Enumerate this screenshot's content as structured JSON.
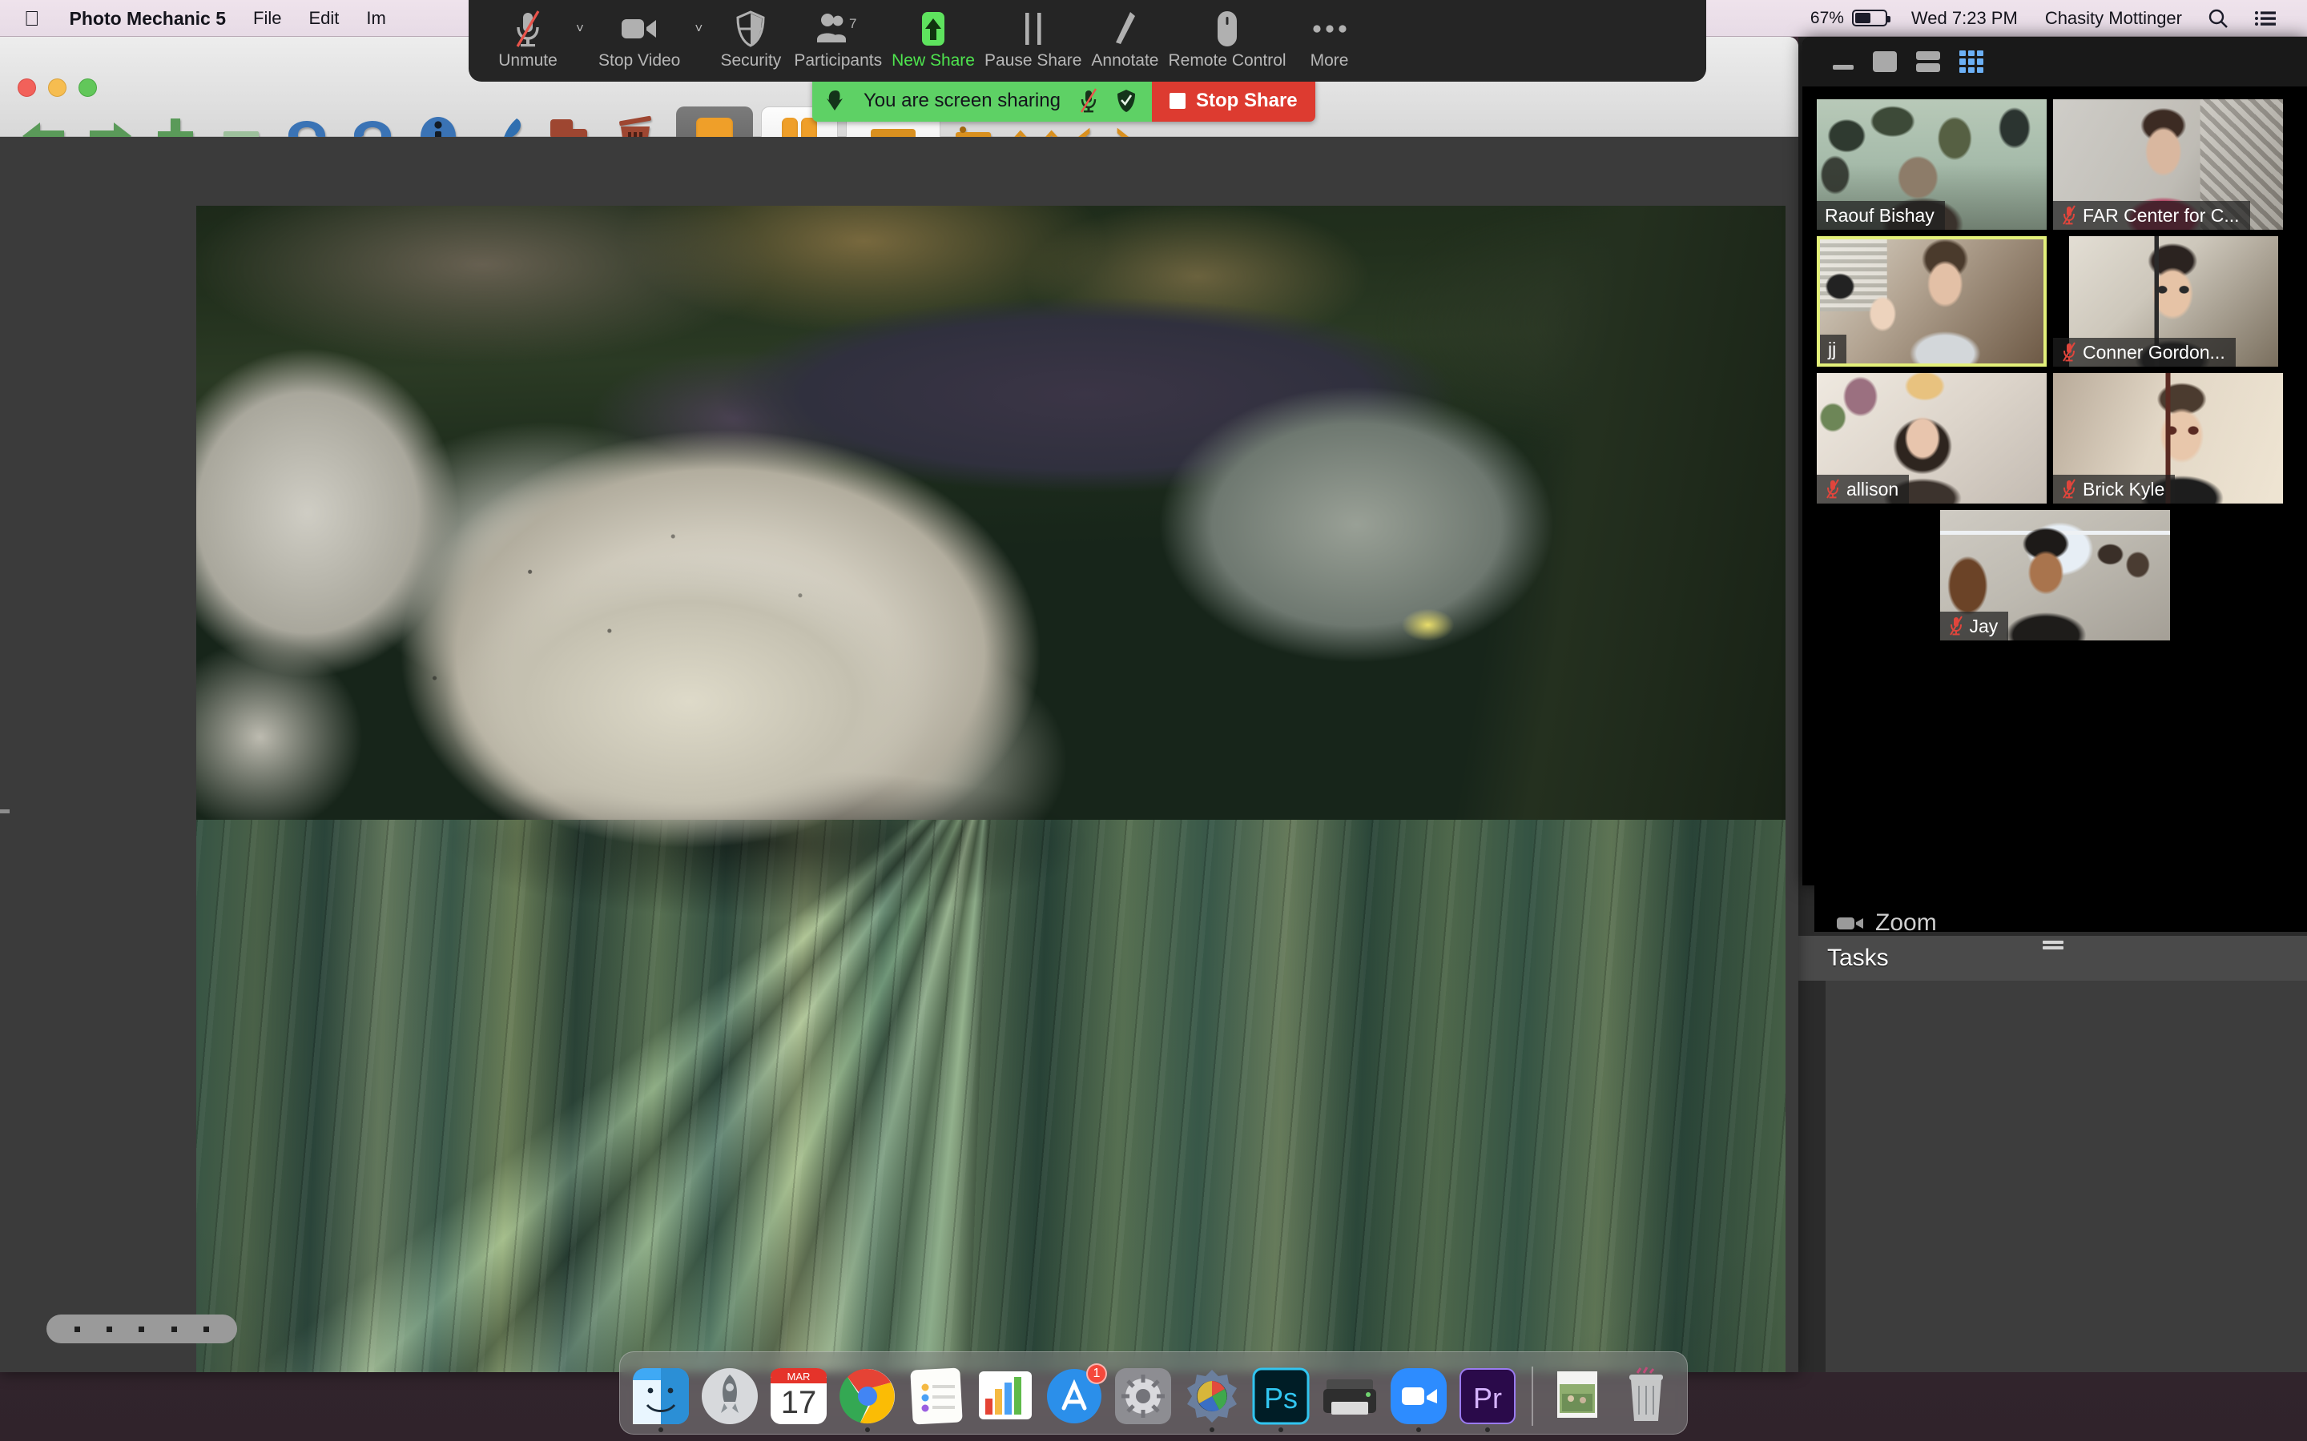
{
  "menubar": {
    "apple_icon": "apple-logo-icon",
    "app_name": "Photo Mechanic 5",
    "menus": [
      "File",
      "Edit",
      "Im"
    ],
    "battery_percent": "67%",
    "clock": "Wed 7:23 PM",
    "user": "Chasity Mottinger",
    "search_icon": "search-icon",
    "control_center_icon": "list-icon"
  },
  "zoom_toolbar": {
    "items": [
      {
        "label": "Unmute",
        "icon": "microphone-muted-icon",
        "caret": true,
        "active": false
      },
      {
        "label": "Stop Video",
        "icon": "video-camera-icon",
        "caret": true,
        "active": false
      },
      {
        "label": "Security",
        "icon": "shield-icon",
        "caret": false,
        "active": false
      },
      {
        "label": "Participants",
        "icon": "participants-icon",
        "caret": false,
        "active": false,
        "count": "7"
      },
      {
        "label": "New Share",
        "icon": "share-screen-up-arrow-icon",
        "caret": false,
        "active": true
      },
      {
        "label": "Pause Share",
        "icon": "pause-icon",
        "caret": false,
        "active": false
      },
      {
        "label": "Annotate",
        "icon": "pen-icon",
        "caret": false,
        "active": false
      },
      {
        "label": "Remote Control",
        "icon": "mouse-icon",
        "caret": false,
        "active": false
      },
      {
        "label": "More",
        "icon": "ellipsis-icon",
        "caret": false,
        "active": false
      }
    ]
  },
  "share_bar": {
    "down_arrow_icon": "arrow-down-icon",
    "message": "You are screen sharing",
    "mic_icon": "microphone-muted-icon",
    "shield_icon": "shield-check-icon",
    "stop_label": "Stop Share",
    "green_hex": "#5ED165",
    "red_hex": "#DD3B30"
  },
  "photo_mechanic": {
    "window_title": "Photo Mechanic 5",
    "traffic_lights": [
      "close-button",
      "minimize-button",
      "zoom-button"
    ],
    "toolbar": [
      {
        "name": "previous-image-button",
        "icon": "arrow-left-icon"
      },
      {
        "name": "next-image-button",
        "icon": "arrow-right-icon"
      },
      {
        "name": "increase-rating-button",
        "icon": "plus-icon"
      },
      {
        "name": "decrease-rating-button",
        "icon": "minus-icon"
      },
      {
        "name": "undo-button",
        "icon": "undo-arrow-icon"
      },
      {
        "name": "redo-button",
        "icon": "redo-arrow-icon"
      },
      {
        "name": "info-button",
        "icon": "info-circle-icon"
      },
      {
        "name": "ingest-button",
        "icon": "quill-icon"
      },
      {
        "name": "copy-button",
        "icon": "copy-squares-icon"
      },
      {
        "name": "trash-button",
        "icon": "trash-icon"
      }
    ],
    "rating_dots": 5
  },
  "background_panel": {
    "strip_label": "Zoom",
    "tasks_label": "Tasks"
  },
  "zoom_panel": {
    "header_icons": [
      "minimize-icon",
      "maximize-icon",
      "split-view-icon",
      "gallery-view-icon"
    ],
    "tiles": [
      {
        "name": "Raouf Bishay",
        "muted": false,
        "speaking": false
      },
      {
        "name": "FAR Center for C...",
        "muted": true,
        "speaking": false
      },
      {
        "name": "jj",
        "muted": false,
        "speaking": true
      },
      {
        "name": "Conner Gordon...",
        "muted": true,
        "speaking": false
      },
      {
        "name": "allison",
        "muted": true,
        "speaking": false
      },
      {
        "name": "Brick Kyle",
        "muted": true,
        "speaking": false
      },
      {
        "name": "Jay",
        "muted": true,
        "speaking": false
      }
    ]
  },
  "dock": {
    "apps": [
      {
        "name": "Finder",
        "icon": "finder-icon",
        "running": true
      },
      {
        "name": "Launchpad",
        "icon": "launchpad-icon",
        "running": false
      },
      {
        "name": "Calendar",
        "icon": "calendar-icon",
        "month": "MAR",
        "day": "17",
        "running": false
      },
      {
        "name": "Google Chrome",
        "icon": "chrome-icon",
        "running": true
      },
      {
        "name": "Notes",
        "icon": "notes-icon",
        "running": false
      },
      {
        "name": "Numbers",
        "icon": "numbers-icon",
        "running": false
      },
      {
        "name": "App Store",
        "icon": "app-store-icon",
        "badge": "1",
        "running": false
      },
      {
        "name": "System Preferences",
        "icon": "gear-icon",
        "running": false
      },
      {
        "name": "Photo Mechanic",
        "icon": "photo-mechanic-icon",
        "running": true
      },
      {
        "name": "Adobe Photoshop",
        "icon": "photoshop-icon",
        "running": true
      },
      {
        "name": "Printer",
        "icon": "printer-icon",
        "running": false
      },
      {
        "name": "Zoom",
        "icon": "zoom-video-icon",
        "running": true
      },
      {
        "name": "Adobe Premiere Pro",
        "icon": "premiere-icon",
        "running": true
      }
    ],
    "stack": {
      "name": "Pictures Stack",
      "icon": "photo-stack-icon"
    },
    "trash": {
      "name": "Trash",
      "icon": "trash-icon"
    }
  }
}
